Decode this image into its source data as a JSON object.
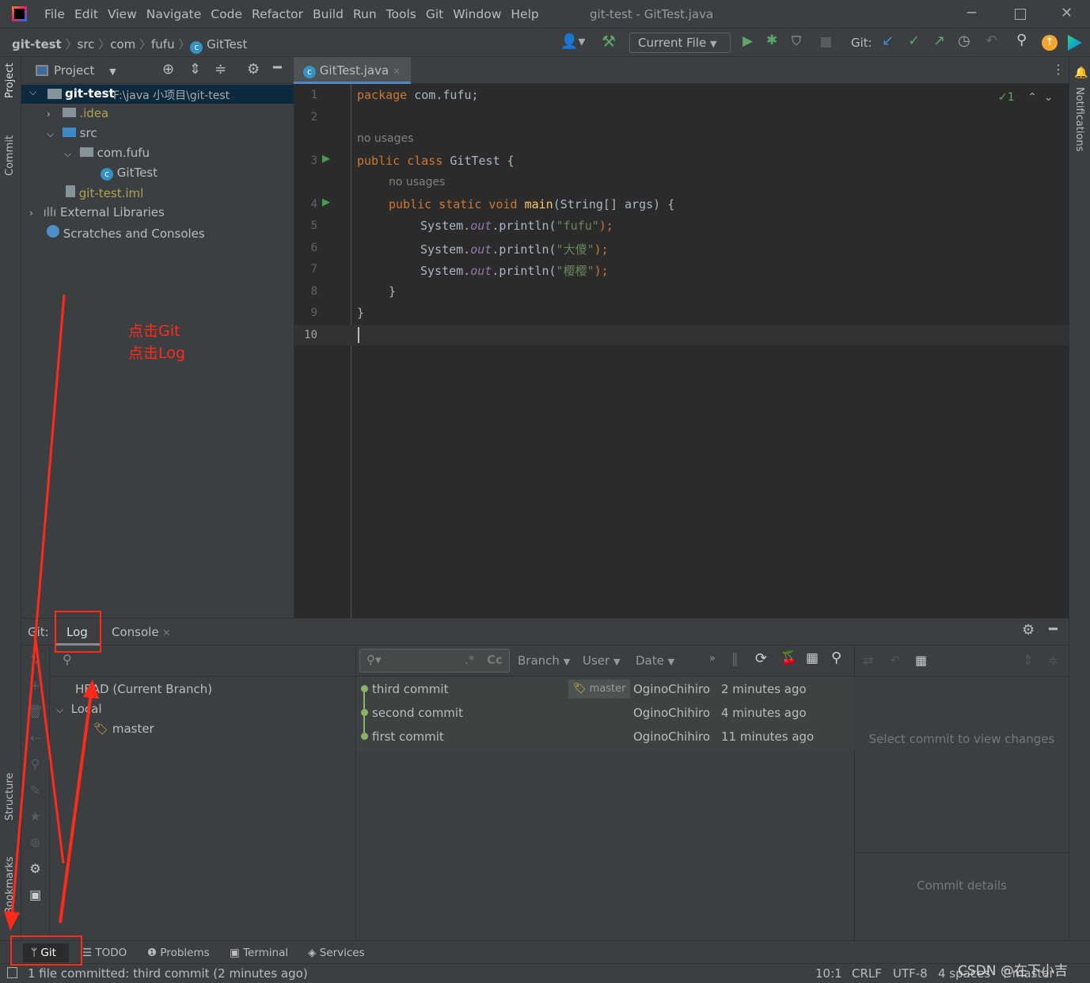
{
  "window": {
    "title": "git-test - GitTest.java",
    "menu": [
      "File",
      "Edit",
      "View",
      "Navigate",
      "Code",
      "Refactor",
      "Build",
      "Run",
      "Tools",
      "Git",
      "Window",
      "Help"
    ]
  },
  "breadcrumb": [
    "git-test",
    "src",
    "com",
    "fufu",
    "GitTest"
  ],
  "toolbar": {
    "run_config": "Current File",
    "git_label": "Git:"
  },
  "left_strip": {
    "project": "Project",
    "commit": "Commit",
    "structure": "Structure",
    "bookmarks": "Bookmarks"
  },
  "right_strip": {
    "notifications": "Notifications"
  },
  "project_panel": {
    "title": "Project",
    "tree": [
      {
        "label": "git-test",
        "path": "F:\\java 小项目\\git-test"
      },
      {
        "label": ".idea"
      },
      {
        "label": "src"
      },
      {
        "label": "com.fufu"
      },
      {
        "label": "GitTest"
      },
      {
        "label": "git-test.iml"
      },
      {
        "label": "External Libraries"
      },
      {
        "label": "Scratches and Consoles"
      }
    ]
  },
  "editor": {
    "tab": "GitTest.java",
    "inspection_count": "1",
    "usage_hint": "no usages",
    "code": {
      "l1a": "package",
      "l1b": " com.fufu;",
      "l3a": "public class",
      "l3b": " GitTest {",
      "l4a": "public static void",
      "l4b": "main",
      "l4c": "(String[] args) {",
      "sys": "System.",
      "out": "out",
      ".println(": ".println(",
      "s1": "\"fufu\"",
      "s2": "\"大傻\"",
      "s3": "\"樱樱\"",
      "end": ");",
      "close_inner": "}",
      "close_outer": "}"
    },
    "line_numbers": [
      "1",
      "2",
      "3",
      "4",
      "5",
      "6",
      "7",
      "8",
      "9",
      "10"
    ]
  },
  "annotation": {
    "line1": "点击Git",
    "line2": "点击Log"
  },
  "git_panel": {
    "label": "Git:",
    "tabs": [
      "Log",
      "Console"
    ],
    "branches": {
      "head": "HEAD (Current Branch)",
      "local": "Local",
      "master": "master"
    },
    "filters": [
      "Branch",
      "User",
      "Date"
    ],
    "commits": [
      {
        "message": "third commit",
        "tag": "master",
        "author": "OginoChihiro",
        "date": "2 minutes ago"
      },
      {
        "message": "second commit",
        "author": "OginoChihiro",
        "date": "4 minutes ago"
      },
      {
        "message": "first commit",
        "author": "OginoChihiro",
        "date": "11 minutes ago"
      }
    ],
    "changes_placeholder": "Select commit to view changes",
    "details_placeholder": "Commit details"
  },
  "tool_windows": [
    "Git",
    "TODO",
    "Problems",
    "Terminal",
    "Services"
  ],
  "status": {
    "message": "1 file committed: third commit (2 minutes ago)",
    "position": "10:1",
    "line_sep": "CRLF",
    "encoding": "UTF-8",
    "indent": "4 spaces",
    "branch": "master"
  },
  "watermark": "CSDN @在下小吉",
  "colors": {
    "accent": "#4a88c7",
    "annotation": "#ff2a1a",
    "graph": "#8db166"
  }
}
